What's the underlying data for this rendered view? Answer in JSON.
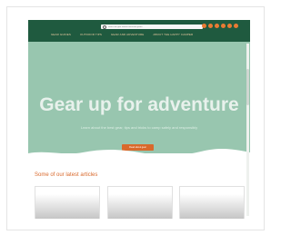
{
  "header": {
    "search": {
      "placeholder": "Search our gear reviews and travel guides"
    },
    "social_icons": [
      "facebook-icon",
      "twitter-icon",
      "instagram-icon",
      "youtube-icon",
      "pinterest-icon",
      "rss-icon"
    ],
    "nav": [
      "GEAR GUIDES",
      "OUTDOOR TIPS",
      "GEAR AND ADVENTURE",
      "ABOUT THE HAPPY CAMPER"
    ]
  },
  "hero": {
    "title": "Gear up for adventure",
    "subtitle": "Learn about the best gear, tips and tricks to camp safely and responsibly",
    "button_label": "Read about gear"
  },
  "latest": {
    "title": "Some of our latest articles",
    "cards": [
      "article-card-1",
      "article-card-2",
      "article-card-3"
    ]
  },
  "colors": {
    "topbar": "#1f5a3f",
    "hero": "#98c6af",
    "accent": "#d9692c"
  }
}
